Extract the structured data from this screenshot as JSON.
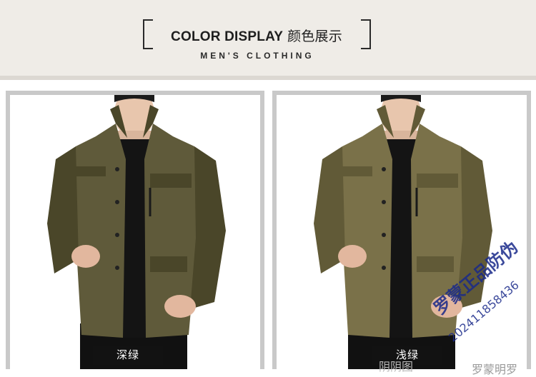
{
  "header": {
    "title_en": "COLOR DISPLAY",
    "title_cn": "颜色展示",
    "subtitle": "MEN'S CLOTHING"
  },
  "products": [
    {
      "label": "深绿",
      "jacket_color": "#5f5a3a",
      "jacket_shade": "#4a4629"
    },
    {
      "label": "浅绿",
      "jacket_color": "#7a7149",
      "jacket_shade": "#615a37"
    }
  ],
  "watermark": {
    "line1": "罗蒙正品防伪",
    "line2": "202411858436",
    "line3": "阴阴图",
    "line4": "罗蒙明罗"
  }
}
